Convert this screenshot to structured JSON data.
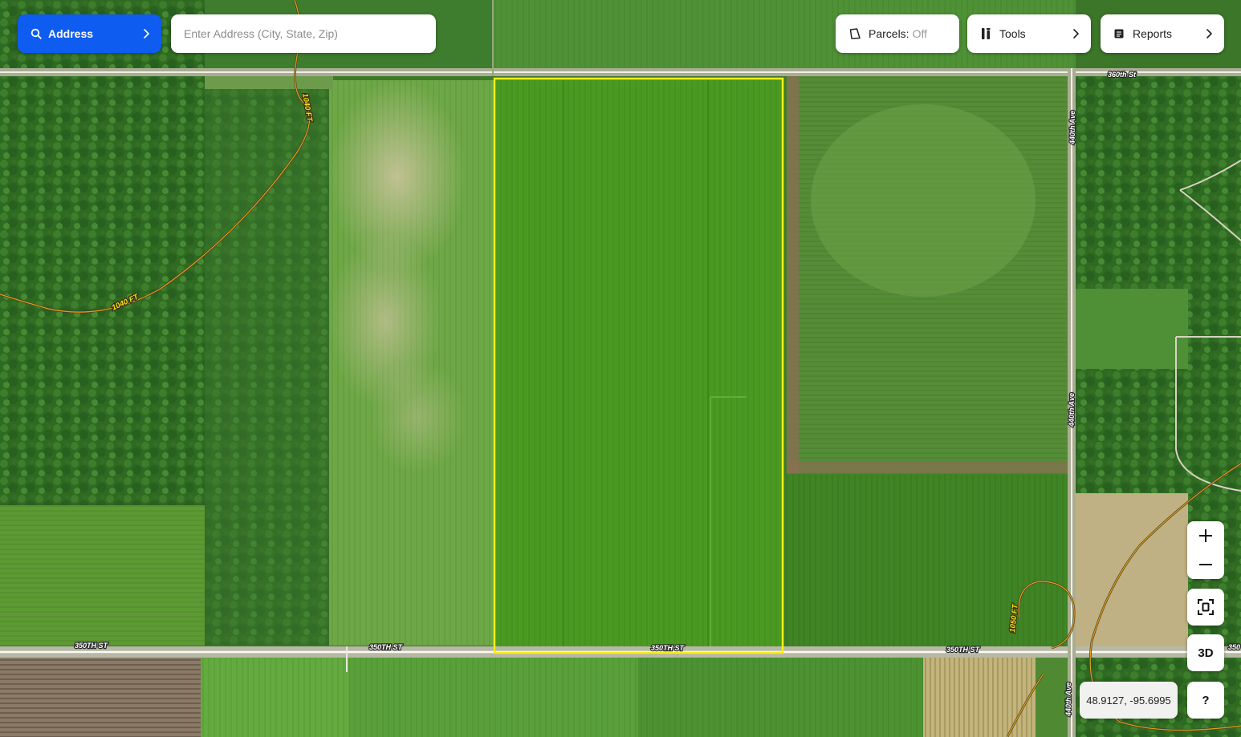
{
  "toolbar": {
    "address_label": "Address",
    "search_placeholder": "Enter Address (City, State, Zip)",
    "parcels_label": "Parcels:",
    "parcels_value": "Off",
    "tools_label": "Tools",
    "reports_label": "Reports"
  },
  "map": {
    "roads": {
      "st_360": "360th St",
      "st_350_a": "350TH ST",
      "st_350_b": "350TH ST",
      "st_350_c": "350TH ST",
      "st_350_d": "350TH ST",
      "st_350_e": "350",
      "ave_440_a": "440th Ave",
      "ave_440_b": "440th Ave",
      "ave_440_c": "440th Ave"
    },
    "contours": {
      "c1040_a": "1040 FT",
      "c1040_b": "1040 FT",
      "c1050": "1050 FT"
    },
    "highlight_color": "#f5ee16"
  },
  "controls": {
    "zoom_in": "+",
    "zoom_out": "−",
    "three_d": "3D",
    "help": "?",
    "coordinates": "48.9127, -95.6995"
  }
}
